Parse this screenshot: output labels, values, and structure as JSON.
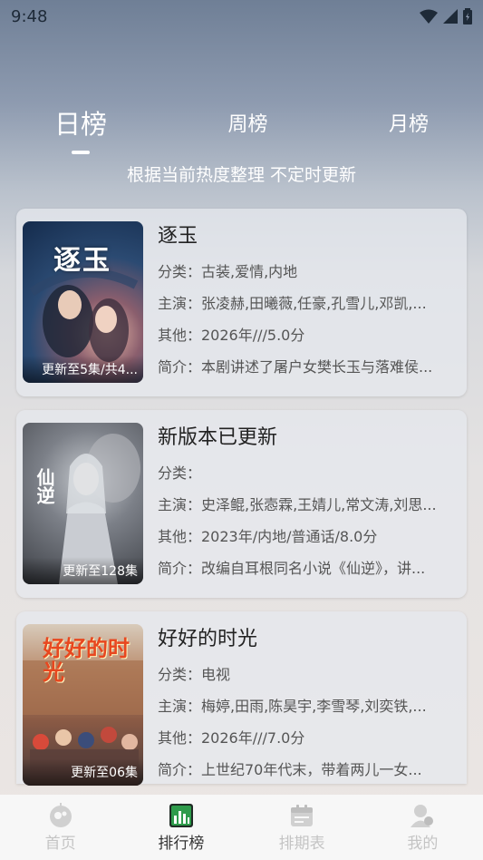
{
  "status_bar": {
    "time": "9:48"
  },
  "tabs": [
    {
      "label": "日榜",
      "active": true
    },
    {
      "label": "周榜",
      "active": false
    },
    {
      "label": "月榜",
      "active": false
    }
  ],
  "subtitle": "根据当前热度整理 不定时更新",
  "items": [
    {
      "title": "逐玉",
      "poster_text": "逐玉",
      "badge": "更新至5集/共4...",
      "category": "分类：古装,爱情,内地",
      "cast": "主演：张凌赫,田曦薇,任豪,孔雪儿,邓凯,...",
      "other": "其他：2026年///5.0分",
      "intro": "简介：本剧讲述了屠户女樊长玉与落难侯..."
    },
    {
      "title": "新版本已更新",
      "poster_text": "仙逆",
      "badge": "更新至128集",
      "category": "分类：",
      "cast": "主演：史泽鲲,张悫霖,王婧儿,常文涛,刘思...",
      "other": "其他：2023年/内地/普通话/8.0分",
      "intro": "简介：改编自耳根同名小说《仙逆》，讲..."
    },
    {
      "title": "好好的时光",
      "poster_text": "好好的时光",
      "badge": "更新至06集",
      "category": "分类：电视",
      "cast": "主演：梅婷,田雨,陈昊宇,李雪琴,刘奕铁,...",
      "other": "其他：2026年///7.0分",
      "intro": "简介：上世纪70年代末，带着两儿一女..."
    }
  ],
  "nav": [
    {
      "label": "首页",
      "icon": "home-icon",
      "active": false
    },
    {
      "label": "排行榜",
      "icon": "ranking-icon",
      "active": true
    },
    {
      "label": "排期表",
      "icon": "calendar-icon",
      "active": false
    },
    {
      "label": "我的",
      "icon": "profile-icon",
      "active": false
    }
  ],
  "colors": {
    "accent": "#2e9b4b",
    "nav_inactive": "#c4c4c4"
  }
}
